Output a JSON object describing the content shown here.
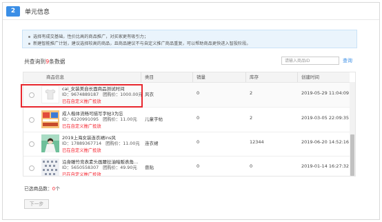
{
  "section": {
    "step": "2",
    "title": "单元信息"
  },
  "notice": {
    "lines": [
      "选择有成交基础，性价比高的商品推广，对买家更有吸引力；",
      "新建智能推广计划，建议选择较高的商品，且商品建议不与自定义推广商品重复，可以帮助商品更快进入智投阶段。"
    ]
  },
  "result": {
    "prefix": "共查询到",
    "count": "9",
    "suffix": "条数据"
  },
  "search": {
    "placeholder": "请输入商品ID",
    "button": "查询"
  },
  "table": {
    "headers": [
      "商品信息",
      "类目",
      "销量",
      "库存",
      "创建时间"
    ],
    "rows": [
      {
        "title": "cai_女装美自长面商品测试时间",
        "id_label": "ID：",
        "id": "9674889187",
        "price_label": "团购价：",
        "price": "1000.00元",
        "promo": "已在自定义推广投放",
        "category": "风衣",
        "sales": "0",
        "stock": "2",
        "created": "2019-05-29 11:04:09",
        "thumb": "tshirt"
      },
      {
        "title": "成人楷体流畅可描写字帖3为忘",
        "id_label": "ID：",
        "id": "6220991095",
        "price_label": "团购价：",
        "price": "11.00元",
        "promo": "已在自定义推广投放",
        "category": "儿童字帖",
        "sales": "0",
        "stock": "2",
        "created": "2019-03-05 22:09:35",
        "thumb": "book"
      },
      {
        "title": "2019上海女装连衣裙ins风",
        "id_label": "ID：",
        "id": "17889367714",
        "price_label": "团购价：",
        "price": "11.00元",
        "promo": "已在自定义推广投放",
        "category": "连衣裙",
        "sales": "0",
        "stock": "12344",
        "created": "2019-06-20 14:52:16",
        "thumb": "photo"
      },
      {
        "title": "沿身雕竹竞表素头画腰拉油暗贩表角…",
        "id_label": "ID：",
        "id": "5650558307",
        "price_label": "团购价：",
        "price": "49.90元",
        "promo": "已在自定义推广投放",
        "category": "兽贴",
        "sales": "0",
        "stock": "0",
        "created": "2019-01-14 16:27:32",
        "thumb": "pattern"
      }
    ]
  },
  "selected": {
    "prefix": "已选商品数：",
    "count": "0",
    "suffix": "个"
  },
  "next_button": "下一步",
  "colors": {
    "accent": "#3a8ee6",
    "alert": "#f5222d",
    "highlight": "#e8262d"
  }
}
